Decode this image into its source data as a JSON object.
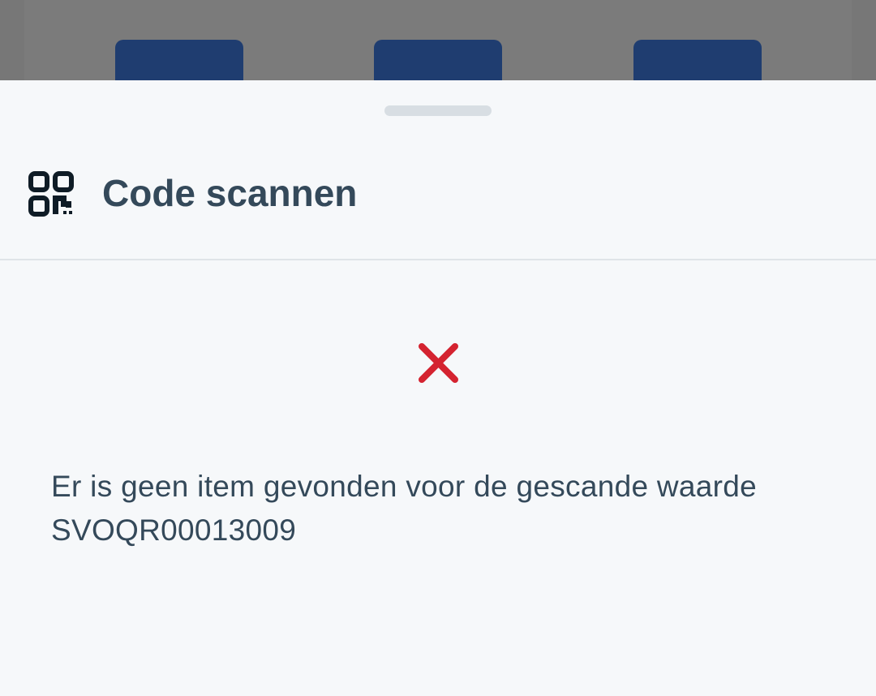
{
  "background": {
    "tiles": [
      "",
      "",
      ""
    ]
  },
  "sheet": {
    "title": "Code scannen",
    "title_icon": "qr-code-scan-icon",
    "status_icon": "close-x-icon",
    "status_color": "#d42330",
    "message_line1": "Er is geen item gevonden voor de gescande waarde",
    "message_line2": "SVOQR00013009"
  },
  "colors": {
    "text": "#34495a",
    "tile": "#1f3d70",
    "sheet_bg": "#f6f8fa",
    "scrim": "#777777"
  }
}
